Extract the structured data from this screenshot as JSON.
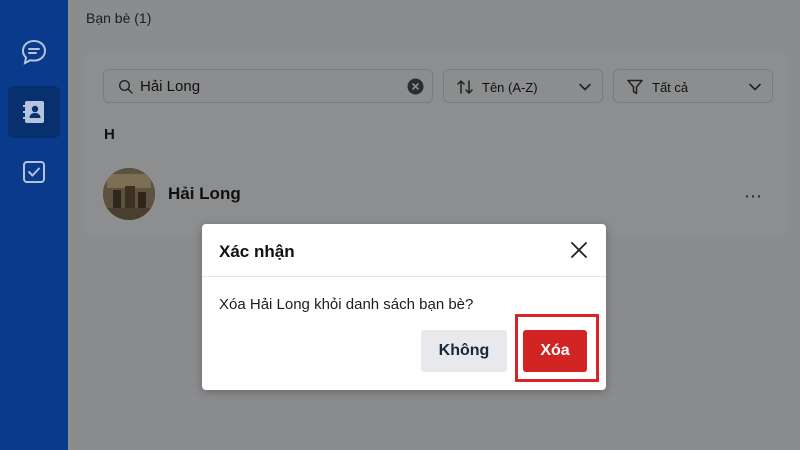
{
  "sidebar": {
    "items": [
      {
        "name": "messages",
        "icon": "chat-bubble-icon"
      },
      {
        "name": "contacts",
        "icon": "contacts-book-icon",
        "active": true
      },
      {
        "name": "todo",
        "icon": "checkbox-icon"
      }
    ]
  },
  "friends": {
    "header": "Bạn bè (1)",
    "search": {
      "value": "Hải Long"
    },
    "sort": {
      "label": "Tên (A-Z)"
    },
    "filter": {
      "label": "Tất cả"
    },
    "group_letter": "H",
    "contacts": [
      {
        "name": "Hải Long"
      }
    ]
  },
  "dialog": {
    "title": "Xác nhận",
    "message": "Xóa Hải Long khỏi danh sách bạn bè?",
    "cancel_label": "Không",
    "confirm_label": "Xóa"
  },
  "colors": {
    "sidebar": "#0a3a8c",
    "confirm_button": "#d32424",
    "highlight": "#d6242a",
    "overlay": "#8b8c8e"
  }
}
